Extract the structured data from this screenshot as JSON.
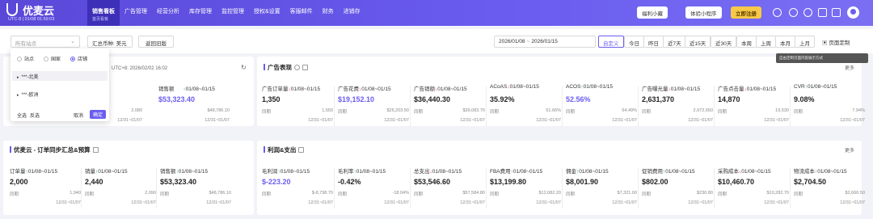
{
  "app": {
    "name": "优麦云",
    "account": "UTC-8 | 01/08 01:59:03"
  },
  "nav": [
    {
      "label": "销售看板",
      "sub": "首页看板",
      "active": true
    },
    {
      "label": "广告管理"
    },
    {
      "label": "经营分析"
    },
    {
      "label": "库存管理"
    },
    {
      "label": "监控管理"
    },
    {
      "label": "授权&设置"
    },
    {
      "label": "客服邮件"
    },
    {
      "label": "财务"
    },
    {
      "label": "进销存"
    }
  ],
  "top_actions": {
    "wechat": "福利小藏",
    "mini": "体验小程序",
    "register": "立即注册"
  },
  "filters": {
    "site_placeholder": "所有站点",
    "currency": "汇总币种: 美元",
    "old_version": "返回旧版",
    "date_start": "2026/01/08",
    "date_end": "2026/01/15",
    "quick": [
      "自定义",
      "今日",
      "昨日",
      "近7天",
      "近15天",
      "近30天",
      "本周",
      "上周",
      "本月",
      "上月"
    ],
    "custom_page": "页面定制",
    "tooltip": "自由定制页面内容展示方式"
  },
  "dropdown": {
    "radios": [
      "站点",
      "国家",
      "店铺"
    ],
    "items": [
      "***-北美",
      "***-欧洲"
    ],
    "select_all": "全选",
    "invert": "反选",
    "cancel": "取消",
    "confirm": "确定"
  },
  "sales_card": {
    "tz": "UTC+8: 2026/02/02 16:02",
    "metric": {
      "label": "销售额",
      "range": "01/08~01/15",
      "value": "$53,323.40",
      "left": "2,080",
      "compare": "$48,786.10",
      "period": "12/31~01/07",
      "left_period": "12/31~01/07"
    }
  },
  "ad_card": {
    "title": "广告表现",
    "more": "更多",
    "metrics": [
      {
        "label": "广告订单量",
        "dir": "dn",
        "range": "01/08~01/15",
        "value": "1,350",
        "compare_label": "同期",
        "compare": "1,550",
        "period": "12/31~01/07"
      },
      {
        "label": "广告花费",
        "dir": "dn",
        "range": "01/08~01/15",
        "value": "$19,152.10",
        "link": true,
        "compare_label": "同期",
        "compare": "$25,203.50",
        "period": "12/31~01/07"
      },
      {
        "label": "广告销额",
        "dir": "dn",
        "range": "01/08~01/15",
        "value": "$36,440.30",
        "compare_label": "同期",
        "compare": "$39,083.70",
        "period": "12/31~01/07"
      },
      {
        "label": "ACoAS",
        "dir": "dn",
        "range": "01/08~01/15",
        "value": "35.92%",
        "compare_label": "同期",
        "compare": "51.66%",
        "period": "12/31~01/07"
      },
      {
        "label": "ACOS",
        "dir": "up",
        "range": "01/08~01/15",
        "value": "52.56%",
        "link": true,
        "compare_label": "同期",
        "compare": "64.49%",
        "period": "12/31~01/07"
      },
      {
        "label": "广告曝光量",
        "dir": "dn",
        "range": "01/08~01/15",
        "value": "2,631,370",
        "compare_label": "同期",
        "compare": "2,972,650",
        "period": "12/31~01/07"
      },
      {
        "label": "广告点击量",
        "dir": "dn",
        "range": "01/08~01/15",
        "value": "14,870",
        "compare_label": "同期",
        "compare": "19,530",
        "period": "12/31~01/07"
      },
      {
        "label": "CVR",
        "dir": "up",
        "range": "01/08~01/15",
        "value": "9.08%",
        "compare_label": "同期",
        "compare": "7.94%",
        "period": "12/31~01/07"
      }
    ]
  },
  "order_card": {
    "title": "优麦云 - 订单同步汇总&预算",
    "metrics": [
      {
        "label": "订单量",
        "dir": "up",
        "range": "01/08~01/15",
        "value": "2,000",
        "compare_label": "同期",
        "compare": "1,940",
        "period": "12/31~01/07"
      },
      {
        "label": "销量",
        "dir": "up",
        "range": "01/08~01/15",
        "value": "2,440",
        "compare_label": "同期",
        "compare": "2,090",
        "period": "12/31~01/07"
      },
      {
        "label": "销售额",
        "dir": "up",
        "range": "01/08~01/15",
        "value": "$53,323.40",
        "compare_label": "同期",
        "compare": "$48,786.10",
        "period": "12/31~01/07"
      }
    ]
  },
  "profit_card": {
    "title": "利润&支出",
    "more": "更多",
    "metrics": [
      {
        "label": "毛利润",
        "dir": "up",
        "range": "01/08~01/15",
        "value": "$-223.20",
        "link": true,
        "compare_label": "同期",
        "compare": "$-8,798.70",
        "period": "12/31~01/07"
      },
      {
        "label": "毛利率",
        "dir": "up",
        "range": "01/08~01/15",
        "value": "-0.42%",
        "compare_label": "同期",
        "compare": "-18.04%",
        "period": "12/31~01/07"
      },
      {
        "label": "总支出",
        "dir": "dn",
        "range": "01/08~01/15",
        "value": "$53,546.60",
        "compare_label": "同期",
        "compare": "$57,584.80",
        "period": "12/31~01/07"
      },
      {
        "label": "FBA费用",
        "dir": "up",
        "range": "01/08~01/15",
        "value": "$13,199.80",
        "compare_label": "同期",
        "compare": "$12,082.20",
        "period": "12/31~01/07"
      },
      {
        "label": "佣金",
        "dir": "up",
        "range": "01/08~01/15",
        "value": "$8,001.90",
        "compare_label": "同期",
        "compare": "$7,321.00",
        "period": "12/31~01/07"
      },
      {
        "label": "促销费用",
        "dir": "up",
        "range": "01/08~01/15",
        "value": "$802.00",
        "compare_label": "同期",
        "compare": "$230.80",
        "period": "12/31~01/07"
      },
      {
        "label": "采购成本",
        "dir": "dn",
        "range": "01/08~01/15",
        "value": "$10,460.70",
        "compare_label": "同期",
        "compare": "$10,282.70",
        "period": "12/31~01/07"
      },
      {
        "label": "物流成本",
        "dir": "up",
        "range": "01/08~01/15",
        "value": "$2,704.50",
        "compare_label": "同期",
        "compare": "$2,666.50",
        "period": "12/31~01/07"
      }
    ]
  }
}
